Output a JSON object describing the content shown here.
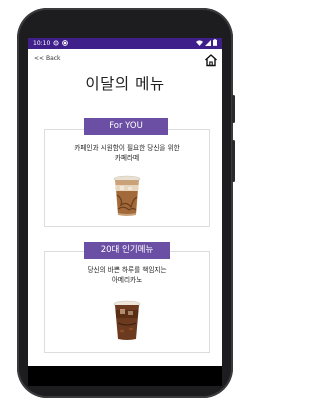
{
  "statusbar": {
    "time": "10:10"
  },
  "header": {
    "back_label": "<< Back",
    "title": "이달의 메뉴"
  },
  "cards": [
    {
      "tag": "For YOU",
      "desc_line1": "카페인과 시원함이 필요한 당신을 위한",
      "desc_line2": "카페라떼"
    },
    {
      "tag": "20대 인기메뉴",
      "desc_line1": "당신의 바쁜 하루를 책임지는",
      "desc_line2": "아메리카노"
    }
  ],
  "colors": {
    "statusbar": "#3f1f8a",
    "tag": "#6b4fa4"
  }
}
